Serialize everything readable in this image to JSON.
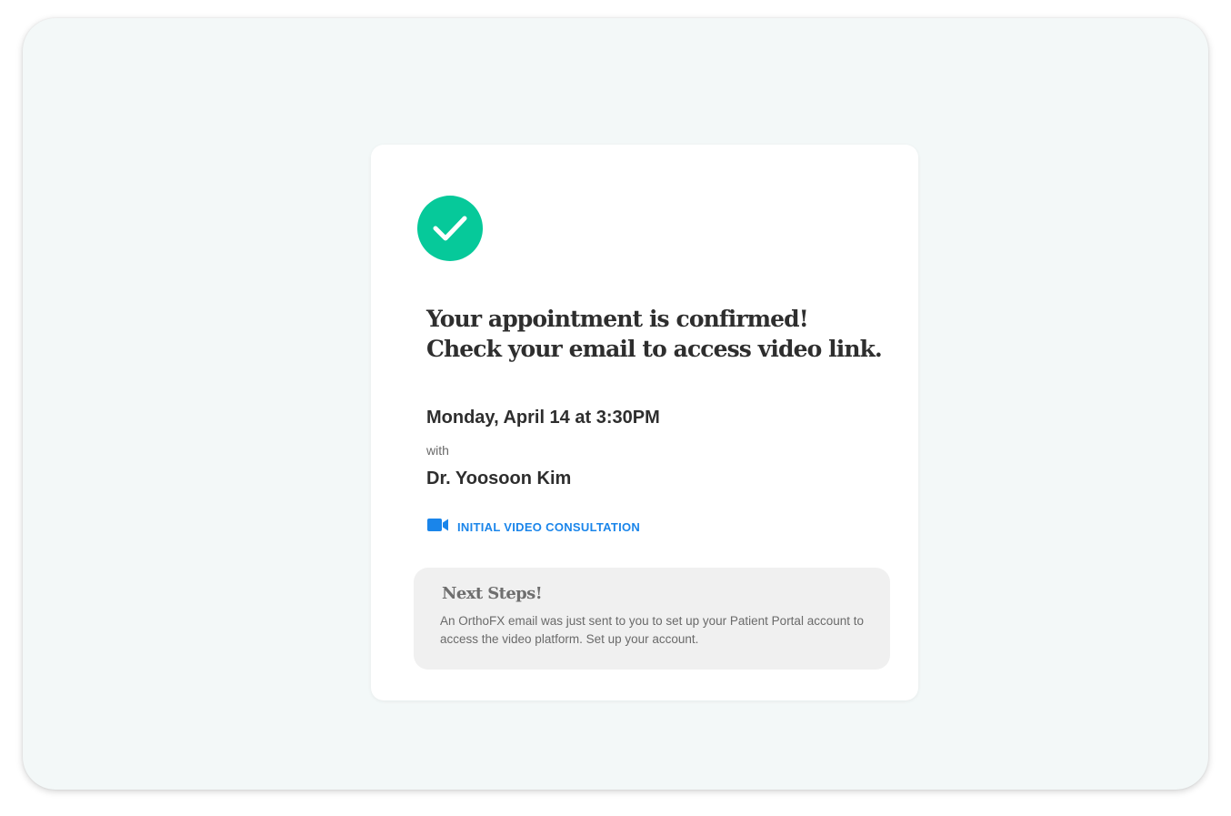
{
  "confirmation": {
    "headline_line1": "Your appointment is confirmed!",
    "headline_line2": "Check your email to access video link.",
    "datetime": "Monday, April 14 at 3:30PM",
    "with_label": "with",
    "doctor": "Dr. Yoosoon Kim",
    "consultation_type": "INITIAL VIDEO CONSULTATION",
    "consultation_icon": "video-camera-icon",
    "status_icon": "checkmark-circle-icon"
  },
  "next_steps": {
    "title": "Next Steps!",
    "body": "An OrthoFX email was just sent to you to set up your Patient Portal account to access the video platform. Set up your account."
  },
  "colors": {
    "frame_background": "#f3f8f8",
    "success_green": "#06c99a",
    "link_blue": "#1a85ea",
    "text_dark": "#2e2e2e",
    "panel_gray": "#f0f0f0"
  }
}
